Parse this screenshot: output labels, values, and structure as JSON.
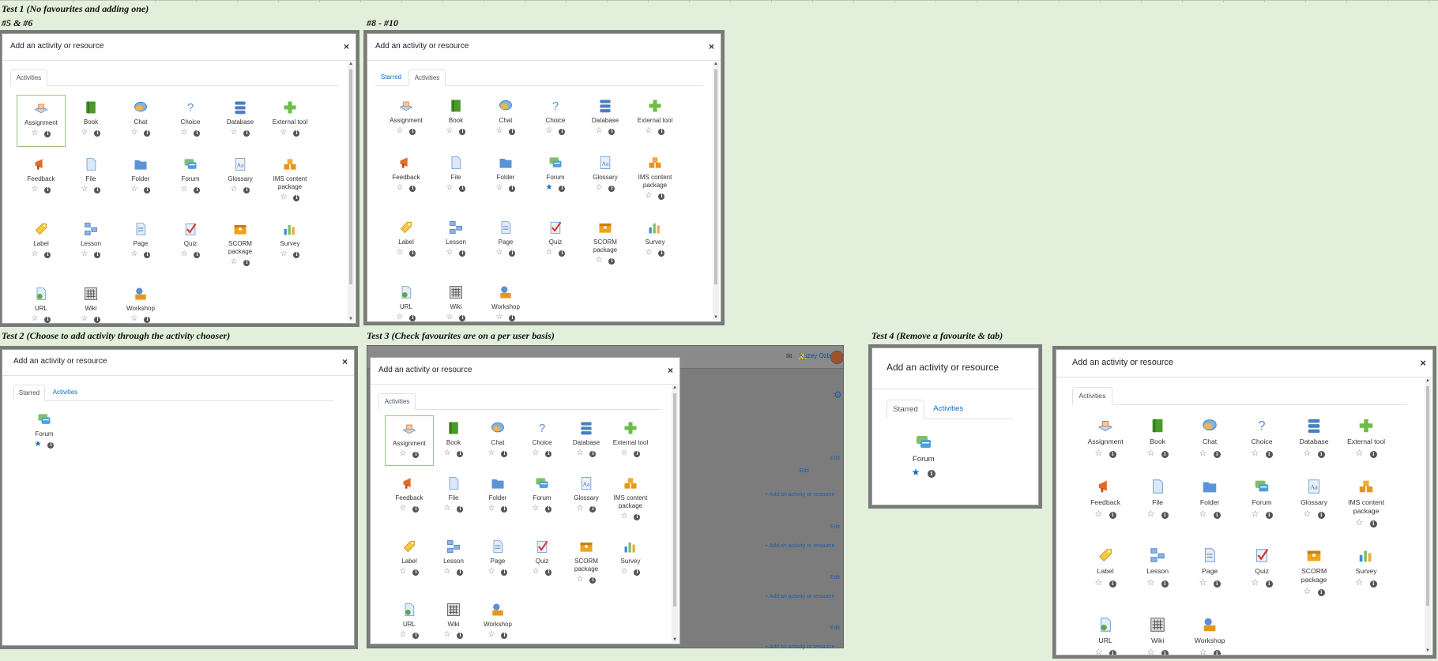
{
  "headings": {
    "test1": "Test 1 (No favourites and adding one)",
    "sub_a": "#5 & #6",
    "sub_b": "#8 - #10",
    "test2": "Test 2 (Choose to add activity through the activity chooser)",
    "test3": "Test 3 (Check favourites are on a per user basis)",
    "test4": "Test 4 (Remove a favourite & tab)"
  },
  "modal": {
    "title": "Add an activity or resource",
    "close": "×"
  },
  "tabs": {
    "starred": "Starred",
    "activities": "Activities"
  },
  "activities": [
    {
      "name": "Assignment",
      "icon": "assignment-icon",
      "lines": 1
    },
    {
      "name": "Book",
      "icon": "book-icon",
      "lines": 1
    },
    {
      "name": "Chat",
      "icon": "chat-icon",
      "lines": 1
    },
    {
      "name": "Choice",
      "icon": "choice-icon",
      "lines": 1
    },
    {
      "name": "Database",
      "icon": "database-icon",
      "lines": 1
    },
    {
      "name": "External tool",
      "icon": "external-tool-icon",
      "lines": 1
    },
    {
      "name": "Feedback",
      "icon": "feedback-icon",
      "lines": 1
    },
    {
      "name": "File",
      "icon": "file-icon",
      "lines": 1
    },
    {
      "name": "Folder",
      "icon": "folder-icon",
      "lines": 1
    },
    {
      "name": "Forum",
      "icon": "forum-icon",
      "lines": 1
    },
    {
      "name": "Glossary",
      "icon": "glossary-icon",
      "lines": 1
    },
    {
      "name": "IMS content package",
      "icon": "ims-package-icon",
      "lines": 2
    },
    {
      "name": "Label",
      "icon": "label-icon",
      "lines": 1
    },
    {
      "name": "Lesson",
      "icon": "lesson-icon",
      "lines": 1
    },
    {
      "name": "Page",
      "icon": "page-icon",
      "lines": 1
    },
    {
      "name": "Quiz",
      "icon": "quiz-icon",
      "lines": 1
    },
    {
      "name": "SCORM package",
      "icon": "scorm-icon",
      "lines": 2
    },
    {
      "name": "Survey",
      "icon": "survey-icon",
      "lines": 1
    },
    {
      "name": "URL",
      "icon": "url-icon",
      "lines": 1
    },
    {
      "name": "Wiki",
      "icon": "wiki-icon",
      "lines": 1
    },
    {
      "name": "Workshop",
      "icon": "workshop-icon",
      "lines": 1
    }
  ],
  "starred_item": {
    "name": "Forum",
    "icon": "forum-icon"
  },
  "background_page": {
    "user_name": "Kuzey Ozbe",
    "edit": "Edit",
    "add_link": "+ Add an activity or resource"
  },
  "colors": {
    "page_bg": "#e2efdb",
    "link": "#0f6cbf",
    "star_on": "#0f6cbf",
    "selected_border": "#9cc08b"
  }
}
